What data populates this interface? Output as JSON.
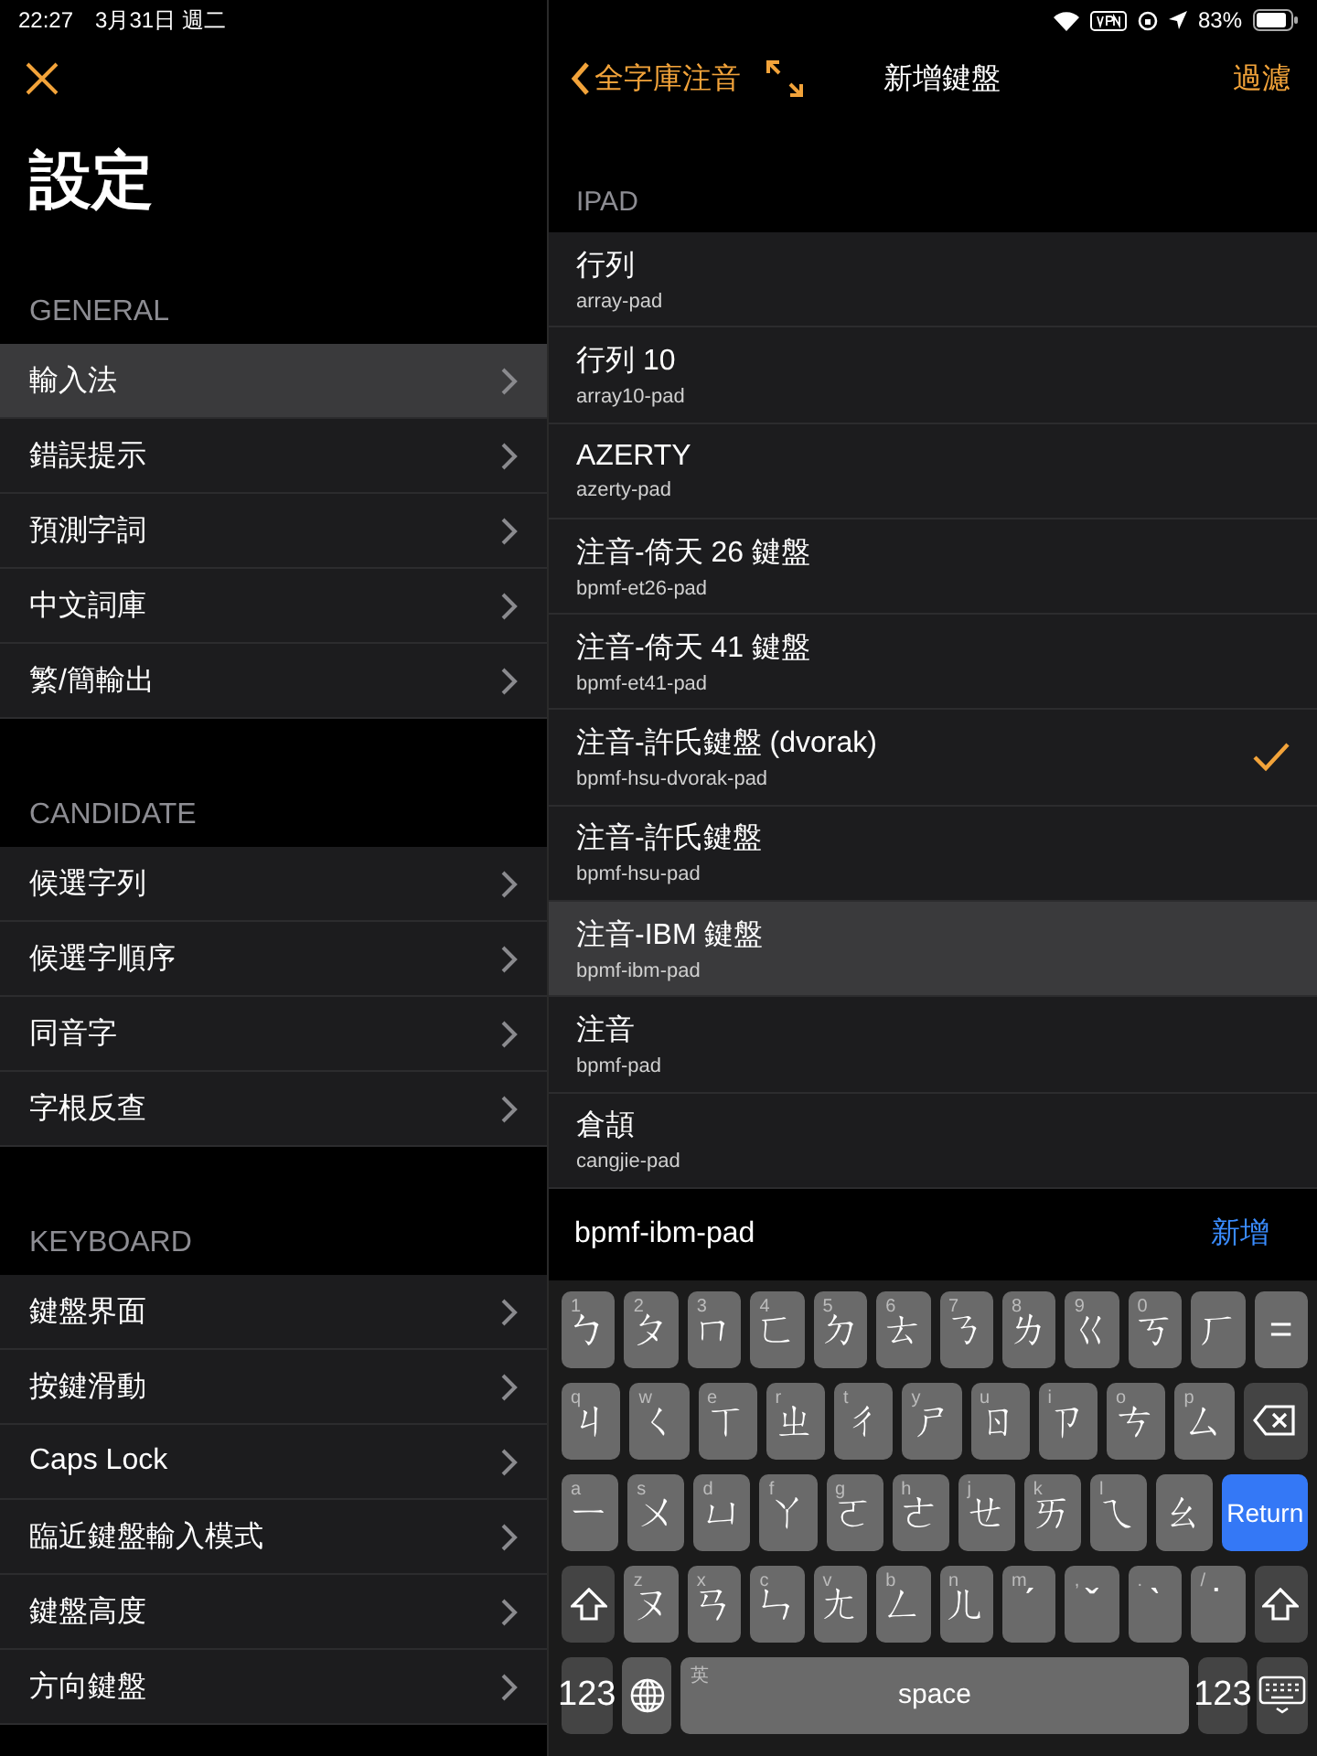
{
  "status_bar": {
    "time": "22:27",
    "date": "3月31日 週二",
    "battery": "83%"
  },
  "settings": {
    "title": "設定",
    "sections": [
      {
        "header": "GENERAL",
        "items": [
          {
            "label": "輸入法",
            "selected": true
          },
          {
            "label": "錯誤提示",
            "selected": false
          },
          {
            "label": "預測字詞",
            "selected": false
          },
          {
            "label": "中文詞庫",
            "selected": false
          },
          {
            "label": "繁/簡輸出",
            "selected": false
          }
        ]
      },
      {
        "header": "CANDIDATE",
        "items": [
          {
            "label": "候選字列",
            "selected": false
          },
          {
            "label": "候選字順序",
            "selected": false
          },
          {
            "label": "同音字",
            "selected": false
          },
          {
            "label": "字根反查",
            "selected": false
          }
        ]
      },
      {
        "header": "KEYBOARD",
        "items": [
          {
            "label": "鍵盤界面",
            "selected": false
          },
          {
            "label": "按鍵滑動",
            "selected": false
          },
          {
            "label": "Caps Lock",
            "selected": false
          },
          {
            "label": "臨近鍵盤輸入模式",
            "selected": false
          },
          {
            "label": "鍵盤高度",
            "selected": false
          },
          {
            "label": "方向鍵盤",
            "selected": false
          }
        ]
      }
    ]
  },
  "keyboard_list": {
    "back": "全字庫注音",
    "title": "新增鍵盤",
    "filter": "過濾",
    "section": "IPAD",
    "items": [
      {
        "name": "行列",
        "id": "array-pad",
        "checked": false,
        "selected": false
      },
      {
        "name": "行列 10",
        "id": "array10-pad",
        "checked": false,
        "selected": false
      },
      {
        "name": "AZERTY",
        "id": "azerty-pad",
        "checked": false,
        "selected": false
      },
      {
        "name": "注音-倚天 26 鍵盤",
        "id": "bpmf-et26-pad",
        "checked": false,
        "selected": false
      },
      {
        "name": "注音-倚天 41 鍵盤",
        "id": "bpmf-et41-pad",
        "checked": false,
        "selected": false
      },
      {
        "name": "注音-許氏鍵盤 (dvorak)",
        "id": "bpmf-hsu-dvorak-pad",
        "checked": true,
        "selected": false
      },
      {
        "name": "注音-許氏鍵盤",
        "id": "bpmf-hsu-pad",
        "checked": false,
        "selected": false
      },
      {
        "name": "注音-IBM 鍵盤",
        "id": "bpmf-ibm-pad",
        "checked": false,
        "selected": true
      },
      {
        "name": "注音",
        "id": "bpmf-pad",
        "checked": false,
        "selected": false
      },
      {
        "name": "倉頡",
        "id": "cangjie-pad",
        "checked": false,
        "selected": false
      }
    ]
  },
  "input_bar": {
    "value": "bpmf-ibm-pad",
    "add": "新增"
  },
  "keyboard": {
    "rows": [
      {
        "keys": [
          {
            "kind": "char",
            "label": "ㄅ",
            "hint": "1"
          },
          {
            "kind": "char",
            "label": "ㄆ",
            "hint": "2"
          },
          {
            "kind": "char",
            "label": "ㄇ",
            "hint": "3"
          },
          {
            "kind": "char",
            "label": "ㄈ",
            "hint": "4"
          },
          {
            "kind": "char",
            "label": "ㄉ",
            "hint": "5"
          },
          {
            "kind": "char",
            "label": "ㄊ",
            "hint": "6"
          },
          {
            "kind": "char",
            "label": "ㄋ",
            "hint": "7"
          },
          {
            "kind": "char",
            "label": "ㄌ",
            "hint": "8"
          },
          {
            "kind": "char",
            "label": "ㄍ",
            "hint": "9"
          },
          {
            "kind": "char",
            "label": "ㄎ",
            "hint": "0"
          },
          {
            "kind": "char",
            "label": "ㄏ"
          },
          {
            "kind": "char",
            "label": "="
          }
        ]
      },
      {
        "keys": [
          {
            "kind": "char",
            "label": "ㄐ",
            "hint": "q"
          },
          {
            "kind": "char",
            "label": "ㄑ",
            "hint": "w"
          },
          {
            "kind": "char",
            "label": "ㄒ",
            "hint": "e"
          },
          {
            "kind": "char",
            "label": "ㄓ",
            "hint": "r"
          },
          {
            "kind": "char",
            "label": "ㄔ",
            "hint": "t"
          },
          {
            "kind": "char",
            "label": "ㄕ",
            "hint": "y"
          },
          {
            "kind": "char",
            "label": "ㄖ",
            "hint": "u"
          },
          {
            "kind": "char",
            "label": "ㄗ",
            "hint": "i"
          },
          {
            "kind": "char",
            "label": "ㄘ",
            "hint": "o"
          },
          {
            "kind": "char",
            "label": "ㄙ",
            "hint": "p"
          },
          {
            "kind": "backspace"
          }
        ]
      },
      {
        "keys": [
          {
            "kind": "char",
            "label": "ㄧ",
            "hint": "a"
          },
          {
            "kind": "char",
            "label": "ㄨ",
            "hint": "s"
          },
          {
            "kind": "char",
            "label": "ㄩ",
            "hint": "d"
          },
          {
            "kind": "char",
            "label": "ㄚ",
            "hint": "f"
          },
          {
            "kind": "char",
            "label": "ㄛ",
            "hint": "g"
          },
          {
            "kind": "char",
            "label": "ㄜ",
            "hint": "h"
          },
          {
            "kind": "char",
            "label": "ㄝ",
            "hint": "j"
          },
          {
            "kind": "char",
            "label": "ㄞ",
            "hint": "k"
          },
          {
            "kind": "char",
            "label": "ㄟ",
            "hint": "l"
          },
          {
            "kind": "char",
            "label": "ㄠ"
          },
          {
            "kind": "return",
            "label": "Return"
          }
        ]
      },
      {
        "keys": [
          {
            "kind": "shift"
          },
          {
            "kind": "char",
            "label": "ㄡ",
            "hint": "z"
          },
          {
            "kind": "char",
            "label": "ㄢ",
            "hint": "x"
          },
          {
            "kind": "char",
            "label": "ㄣ",
            "hint": "c"
          },
          {
            "kind": "char",
            "label": "ㄤ",
            "hint": "v"
          },
          {
            "kind": "char",
            "label": "ㄥ",
            "hint": "b"
          },
          {
            "kind": "char",
            "label": "ㄦ",
            "hint": "n"
          },
          {
            "kind": "char",
            "label": "ˊ",
            "hint": "m"
          },
          {
            "kind": "char",
            "label": "ˇ",
            "hint": ","
          },
          {
            "kind": "char",
            "label": "ˋ",
            "hint": "."
          },
          {
            "kind": "char",
            "label": "˙",
            "hint": "/"
          },
          {
            "kind": "shift"
          }
        ]
      },
      {
        "keys": [
          {
            "kind": "numbers",
            "label": "123"
          },
          {
            "kind": "globe"
          },
          {
            "kind": "space",
            "label": "space",
            "hint": "英"
          },
          {
            "kind": "numbers",
            "label": "123"
          },
          {
            "kind": "dismiss"
          }
        ]
      }
    ]
  }
}
